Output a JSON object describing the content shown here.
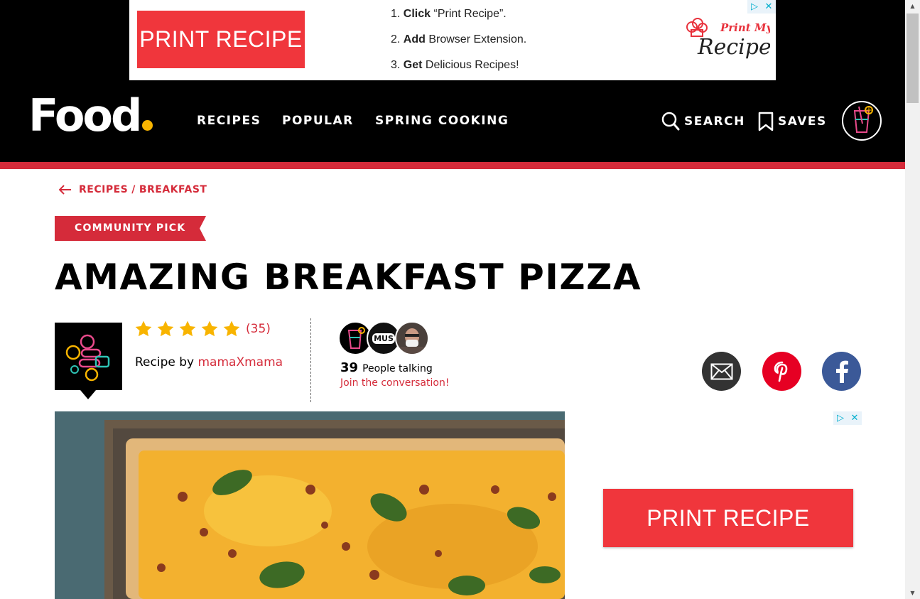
{
  "ad_top": {
    "button_label": "PRINT RECIPE",
    "steps": [
      {
        "num": "1.",
        "verb": "Click",
        "rest": " “Print Recipe”."
      },
      {
        "num": "2.",
        "verb": "Add",
        "rest": " Browser Extension."
      },
      {
        "num": "3.",
        "verb": "Get",
        "rest": " Delicious Recipes!"
      }
    ],
    "logo_line1": "Print My",
    "logo_line2": "Recipes"
  },
  "header": {
    "brand": "Food",
    "nav": [
      "RECIPES",
      "POPULAR",
      "SPRING COOKING"
    ],
    "search_label": "SEARCH",
    "saves_label": "SAVES"
  },
  "breadcrumb": {
    "parent": "RECIPES",
    "separator": "/",
    "current": "BREAKFAST"
  },
  "badge": "COMMUNITY PICK",
  "recipe": {
    "title": "AMAZING BREAKFAST PIZZA",
    "rating_stars": 5,
    "rating_count": "(35)",
    "by_label": "Recipe by",
    "author": "mamaXmama"
  },
  "conversation": {
    "count": "39",
    "label": "People talking",
    "join": "Join the conversation!",
    "avatar_text": "MUS"
  },
  "share_icons": [
    "email-icon",
    "pinterest-icon",
    "facebook-icon"
  ],
  "ad_side": {
    "button_label": "PRINT RECIPE"
  },
  "colors": {
    "brand_red": "#d52b3a",
    "ad_red": "#f0363c",
    "star_yellow": "#f8b400",
    "pinterest": "#e60023",
    "facebook": "#3b5998",
    "email": "#333333"
  }
}
